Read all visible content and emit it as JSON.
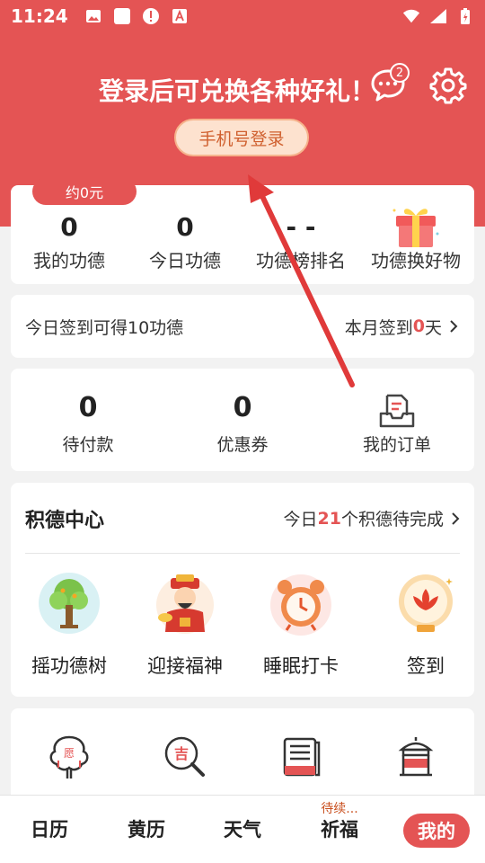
{
  "status_bar": {
    "time": "11:24",
    "icons": [
      "image-icon",
      "square-icon",
      "alert-icon",
      "font-icon"
    ],
    "right_icons": [
      "wifi-icon",
      "signal-icon",
      "battery-icon"
    ]
  },
  "header": {
    "title": "登录后可兑换各种好礼！",
    "message_badge": "2",
    "login_button": "手机号登录",
    "bg_color": "#e45454"
  },
  "stats": {
    "approx_value": "约0元",
    "items": [
      {
        "value": "0",
        "label": "我的功德"
      },
      {
        "value": "0",
        "label": "今日功德"
      },
      {
        "value": "- -",
        "label": "功德榜排名"
      },
      {
        "label": "功德换好物"
      }
    ]
  },
  "signin": {
    "left_text": "今日签到可得10功德",
    "right_prefix": "本月签到",
    "right_days": "0",
    "right_suffix": "天"
  },
  "orders": [
    {
      "value": "0",
      "label": "待付款"
    },
    {
      "value": "0",
      "label": "优惠券"
    },
    {
      "label": "我的订单"
    }
  ],
  "merit_center": {
    "title": "积德中心",
    "link_prefix": "今日",
    "link_count": "21",
    "link_suffix": "个积德待完成",
    "items": [
      {
        "label": "摇功德树",
        "icon": "tree-icon"
      },
      {
        "label": "迎接福神",
        "icon": "fortune-god-icon"
      },
      {
        "label": "睡眠打卡",
        "icon": "alarm-clock-icon"
      },
      {
        "label": "签到",
        "icon": "lotus-icon"
      }
    ]
  },
  "tools": [
    {
      "label": "",
      "icon": "wish-tree-icon"
    },
    {
      "label": "",
      "icon": "lucky-search-icon"
    },
    {
      "label": "",
      "icon": "document-icon"
    },
    {
      "label": "",
      "icon": "temple-icon"
    }
  ],
  "tabbar": {
    "tabs": [
      {
        "label": "日历"
      },
      {
        "label": "黄历"
      },
      {
        "label": "天气"
      },
      {
        "label": "祈福",
        "sub": "待续..."
      }
    ],
    "active": "我的"
  },
  "colors": {
    "accent": "#e45454",
    "arrow": "#e03a3a"
  }
}
